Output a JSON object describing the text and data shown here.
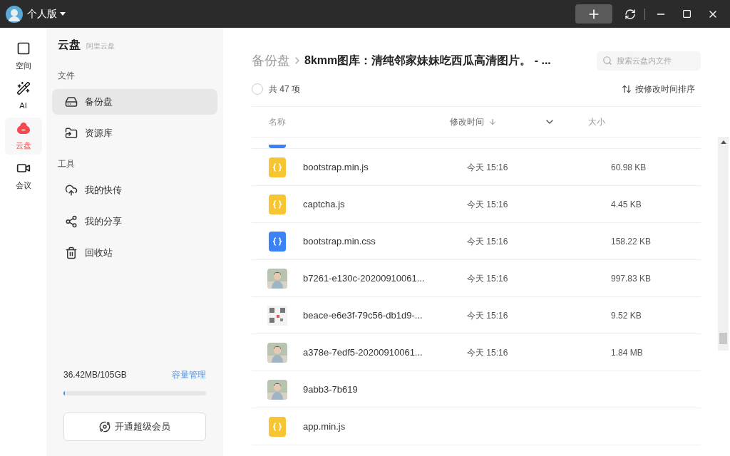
{
  "titlebar": {
    "edition": "个人版"
  },
  "rail": [
    {
      "label": "空间",
      "selected": false
    },
    {
      "label": "AI",
      "selected": false
    },
    {
      "label": "云盘",
      "selected": true
    },
    {
      "label": "会议",
      "selected": false
    }
  ],
  "nav": {
    "title": "云盘",
    "subtitle": "阿里云盘",
    "sections": [
      {
        "heading": "文件",
        "items": [
          {
            "label": "备份盘",
            "selected": true
          },
          {
            "label": "资源库",
            "selected": false
          }
        ]
      },
      {
        "heading": "工具",
        "items": [
          {
            "label": "我的快传",
            "selected": false
          },
          {
            "label": "我的分享",
            "selected": false
          },
          {
            "label": "回收站",
            "selected": false
          }
        ]
      }
    ],
    "storage": {
      "used": "36.42MB/105GB",
      "manage": "容量管理",
      "level": 0.01
    },
    "vip_button": "开通超级会员"
  },
  "breadcrumb": {
    "root": "备份盘",
    "current": "8kmm图库：清纯邻家妹妹吃西瓜高清图片。 - ..."
  },
  "search": {
    "placeholder": "搜索云盘内文件"
  },
  "summary": {
    "checked": false,
    "count": "共 47 项",
    "sort": "按修改时间排序"
  },
  "table": {
    "columns": [
      "名称",
      "修改时间",
      "大小"
    ],
    "rows": [
      {
        "kind": "css"
      },
      {
        "kind": "js",
        "name": "bootstrap.min.js",
        "time": "今天 15:16",
        "size": "60.98 KB"
      },
      {
        "kind": "js",
        "name": "captcha.js",
        "time": "今天 15:16",
        "size": "4.45 KB"
      },
      {
        "kind": "css",
        "name": "bootstrap.min.css",
        "time": "今天 15:16",
        "size": "158.22 KB"
      },
      {
        "name": "b7261-e130c-20200910061...",
        "time": "今天 15:16",
        "size": "997.83 KB"
      },
      {
        "kind": "qr",
        "name": "beace-e6e3f-79c56-db1d9-...",
        "time": "今天 15:16",
        "size": "9.52 KB"
      },
      {
        "name": "a378e-7edf5-20200910061...",
        "time": "今天 15:16",
        "size": "1.84 MB"
      },
      {
        "name": "9abb3-7b619"
      },
      {
        "kind": "js",
        "name": "app.min.js"
      }
    ]
  }
}
